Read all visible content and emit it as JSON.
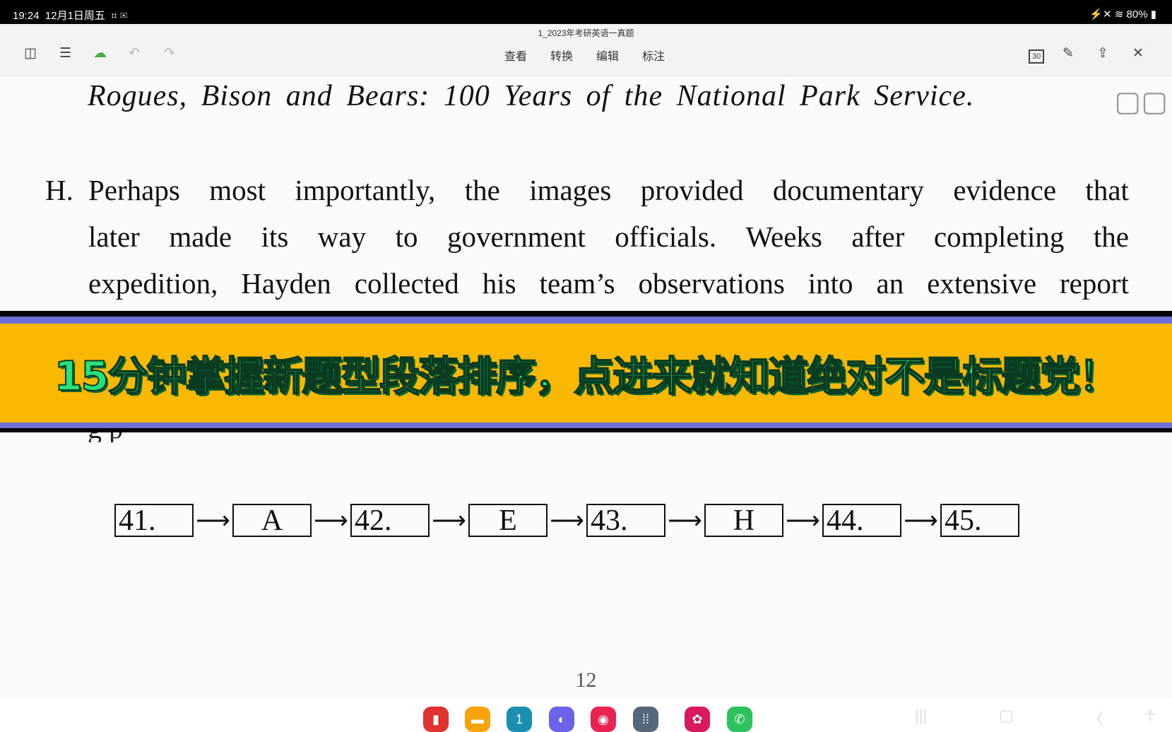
{
  "status": {
    "time": "19:24",
    "date": "12月1日周五",
    "battery": "80%"
  },
  "doc": {
    "title": "1_2023年考研英语一真题"
  },
  "menu": [
    "查看",
    "转换",
    "编辑",
    "标注"
  ],
  "toolbar": {
    "calendar_label": "30"
  },
  "content": {
    "italic_line": "Rogues, Bison and Bears: 100 Years of the National Park Service.",
    "para_label": "H.",
    "para_lines": [
      "Perhaps most importantly, the images provided documentary evidence that",
      "later made its way to government officials. Weeks after completing the",
      "expedition, Hayden collected his team’s observations into an extensive report"
    ],
    "cut_line": "g p",
    "sequence": [
      "41.",
      "A",
      "42.",
      "E",
      "43.",
      "H",
      "44.",
      "45."
    ],
    "page_number": "12"
  },
  "banner": {
    "text": "15分钟掌握新题型段落排序，点进来就知道绝对不是标题党！",
    "yellow": "#fbb800",
    "purple": "#6f6fd8",
    "text_color": "#29e07a"
  },
  "dock": {
    "apps": [
      {
        "name": "notes",
        "color": "#e0332f"
      },
      {
        "name": "files",
        "color": "#f6a30c"
      },
      {
        "name": "calendar",
        "color": "#1a8fb0",
        "label": "1"
      },
      {
        "name": "internet",
        "color": "#6b63e8"
      },
      {
        "name": "screen-recorder",
        "color": "#e8234f"
      },
      {
        "name": "apps",
        "color": "#55677a"
      },
      {
        "name": "gallery",
        "color": "#d8195e"
      },
      {
        "name": "wechat",
        "color": "#2dc25d"
      }
    ]
  }
}
